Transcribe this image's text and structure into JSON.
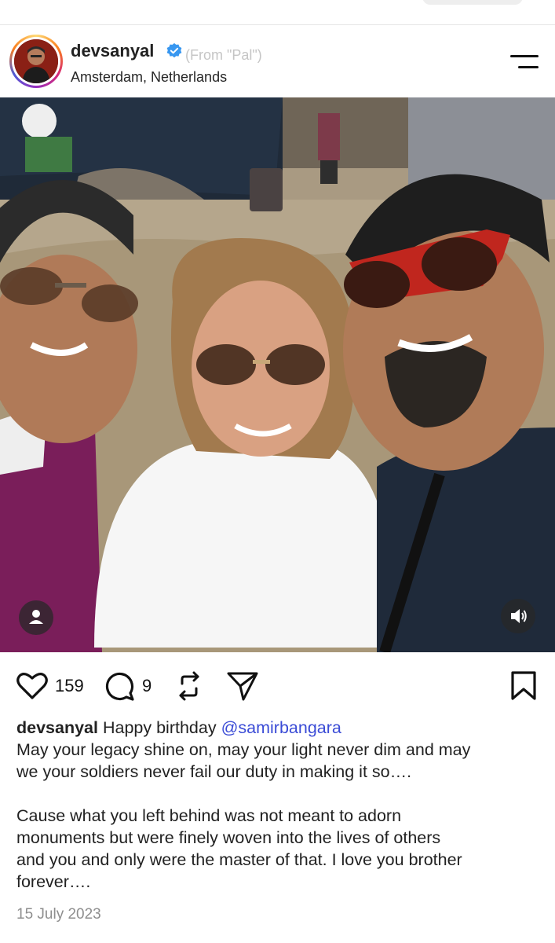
{
  "top_bar": {
    "title_fragment": ""
  },
  "post": {
    "username": "devsanyal",
    "verified": true,
    "audio_hint": "(From \"Pal\")",
    "location": "Amsterdam, Netherlands",
    "image_alt": "Selfie of three people wearing sunglasses outdoors"
  },
  "actions": {
    "like_count": "159",
    "comment_count": "9"
  },
  "caption": {
    "username": "devsanyal",
    "text_start": "Happy birthday",
    "mention": "@samirbangara",
    "line_2": "May your legacy shine on, may your light never dim and may",
    "line_3": "we your soldiers never fail our duty in making it so….",
    "para_2_line_1": "Cause what you left behind was not meant to adorn",
    "para_2_line_2": "monuments but were finely woven into the lives of others",
    "para_2_line_3": "and you and only were the master of that. I love you brother",
    "para_2_line_4": "forever…."
  },
  "date": "15 July 2023",
  "colors": {
    "verified_blue": "#3897f0",
    "mention_blue": "#3a4bd6",
    "date_gray": "#8e8e8e"
  },
  "icons": [
    "heart-icon",
    "comment-icon",
    "repost-icon",
    "share-icon",
    "bookmark-icon",
    "menu-icon",
    "tag-person-icon",
    "sound-icon",
    "verified-badge-icon"
  ]
}
